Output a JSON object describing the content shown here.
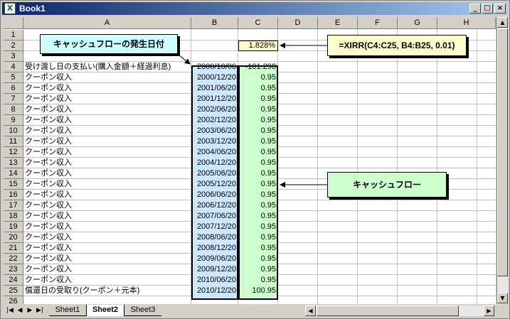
{
  "window": {
    "title": "Book1",
    "app_icon_glyph": "X",
    "buttons": [
      "_",
      "□",
      "×"
    ]
  },
  "columns": [
    "A",
    "B",
    "C",
    "D",
    "E",
    "F",
    "G",
    "H"
  ],
  "rows": [
    "1",
    "2",
    "3",
    "4",
    "5",
    "6",
    "7",
    "8",
    "9",
    "10",
    "11",
    "12",
    "13",
    "14",
    "15",
    "16",
    "17",
    "18",
    "19",
    "20",
    "21",
    "22",
    "23",
    "24",
    "25",
    "26"
  ],
  "cells": {
    "C2": "1.828%",
    "data": [
      {
        "a": "受け渡し日の支払い(購入金額＋経過利息)",
        "b": "2000/10/06",
        "c": "-101.298"
      },
      {
        "a": "クーポン収入",
        "b": "2000/12/20",
        "c": "0.95"
      },
      {
        "a": "クーポン収入",
        "b": "2001/06/20",
        "c": "0.95"
      },
      {
        "a": "クーポン収入",
        "b": "2001/12/20",
        "c": "0.95"
      },
      {
        "a": "クーポン収入",
        "b": "2002/06/20",
        "c": "0.95"
      },
      {
        "a": "クーポン収入",
        "b": "2002/12/20",
        "c": "0.95"
      },
      {
        "a": "クーポン収入",
        "b": "2003/06/20",
        "c": "0.95"
      },
      {
        "a": "クーポン収入",
        "b": "2003/12/20",
        "c": "0.95"
      },
      {
        "a": "クーポン収入",
        "b": "2004/06/20",
        "c": "0.95"
      },
      {
        "a": "クーポン収入",
        "b": "2004/12/20",
        "c": "0.95"
      },
      {
        "a": "クーポン収入",
        "b": "2005/06/20",
        "c": "0.95"
      },
      {
        "a": "クーポン収入",
        "b": "2005/12/20",
        "c": "0.95"
      },
      {
        "a": "クーポン収入",
        "b": "2006/06/20",
        "c": "0.95"
      },
      {
        "a": "クーポン収入",
        "b": "2006/12/20",
        "c": "0.95"
      },
      {
        "a": "クーポン収入",
        "b": "2007/06/20",
        "c": "0.95"
      },
      {
        "a": "クーポン収入",
        "b": "2007/12/20",
        "c": "0.95"
      },
      {
        "a": "クーポン収入",
        "b": "2008/06/20",
        "c": "0.95"
      },
      {
        "a": "クーポン収入",
        "b": "2008/12/20",
        "c": "0.95"
      },
      {
        "a": "クーポン収入",
        "b": "2009/06/20",
        "c": "0.95"
      },
      {
        "a": "クーポン収入",
        "b": "2009/12/20",
        "c": "0.95"
      },
      {
        "a": "クーポン収入",
        "b": "2010/06/20",
        "c": "0.95"
      },
      {
        "a": "償還日の受取り(クーポン＋元本)",
        "b": "2010/12/20",
        "c": "100.95"
      }
    ]
  },
  "callouts": {
    "cashflow_dates": "キャッシュフローの発生日付",
    "formula": "=XIRR(C4:C25, B4:B25, 0.01)",
    "cashflow": "キャッシュフロー"
  },
  "sheets": [
    "Sheet1",
    "Sheet2",
    "Sheet3"
  ],
  "active_sheet": "Sheet2",
  "colors": {
    "title_gradient_start": "#0a246a",
    "col_b_fill": "#cce7ff",
    "col_c_fill": "#ccffcc",
    "c2_fill": "#ffffcc"
  }
}
